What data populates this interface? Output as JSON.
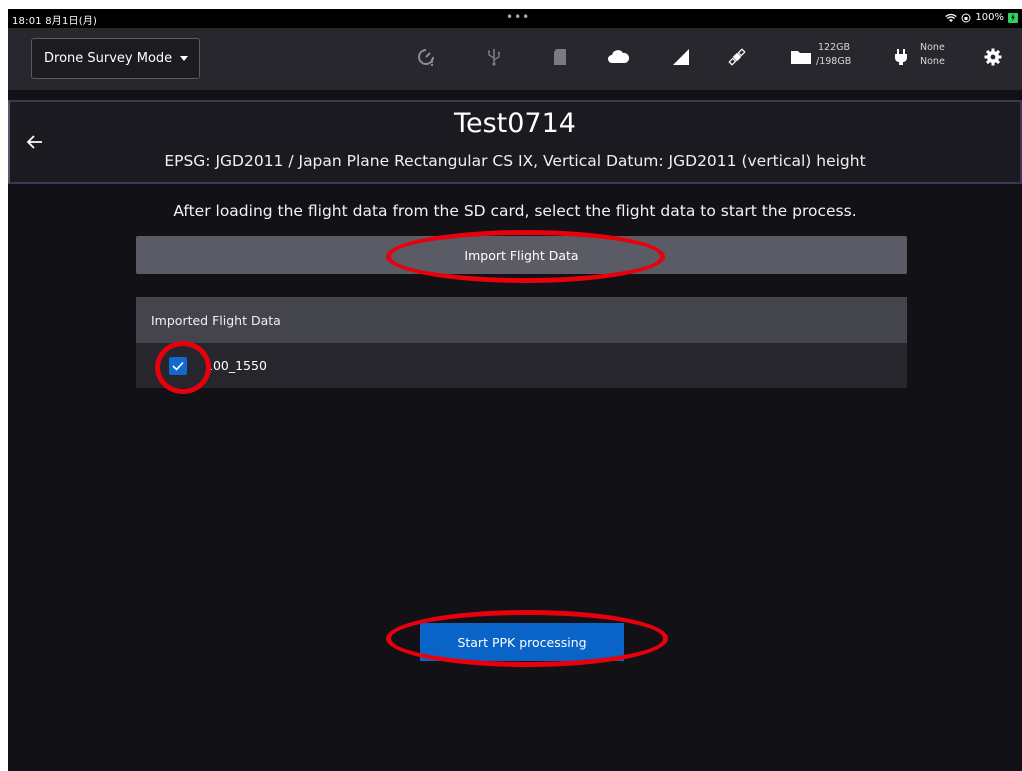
{
  "status_bar": {
    "time": "18:01  8月1日(月)",
    "dots": "•••",
    "battery_text": "100%"
  },
  "toolbar": {
    "mode_select_value": "Drone Survey Mode",
    "storage_used": "122GB",
    "storage_total": "/198GB",
    "power_line1": "None",
    "power_line2": "None",
    "icons": [
      "timer-alert-icon",
      "usb-icon",
      "sd-card-icon",
      "cloud-icon",
      "signal-icon",
      "satellite-icon",
      "folder-icon",
      "plug-icon",
      "gear-icon"
    ]
  },
  "project": {
    "title": "Test0714",
    "subtitle": "EPSG: JGD2011 / Japan Plane Rectangular CS IX, Vertical Datum: JGD2011 (vertical) height"
  },
  "instruction": "After loading the flight data from the SD card, select the flight data to start the process.",
  "import_button_label": "Import Flight Data",
  "imported_panel": {
    "header": "Imported Flight Data",
    "items": [
      {
        "name": "100_1550",
        "checked": true
      }
    ]
  },
  "ppk_button_label": "Start PPK processing",
  "colors": {
    "accent_blue": "#0a63c6",
    "checkbox_blue": "#1168d0",
    "annotation_red": "#e8000d",
    "background": "#111116"
  }
}
